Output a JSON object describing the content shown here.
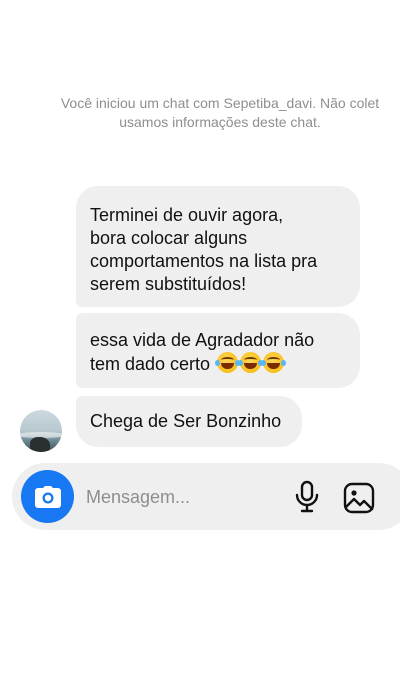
{
  "chat": {
    "system_notice": {
      "line1": "Você iniciou um chat com Sepetiba_davi. Não colet",
      "line2": "usamos informações deste chat."
    },
    "messages": [
      {
        "lines": [
          "Terminei de ouvir agora,",
          "bora colocar alguns",
          "comportamentos na lista pra",
          "serem substituídos!"
        ]
      },
      {
        "lines": [
          "essa vida de Agradador não",
          "tem dado certo"
        ],
        "emojis": [
          "face-with-tears-of-joy",
          "face-with-tears-of-joy",
          "face-with-tears-of-joy"
        ]
      },
      {
        "lines": [
          "Chega de Ser Bonzinho"
        ]
      }
    ]
  },
  "composer": {
    "placeholder": "Mensagem...",
    "value": ""
  },
  "icons": {
    "camera": "camera-icon",
    "mic": "microphone-icon",
    "gallery": "image-icon"
  },
  "colors": {
    "accent": "#1877f2",
    "bubble": "#efefef",
    "muted_text": "#8e8e8e"
  }
}
